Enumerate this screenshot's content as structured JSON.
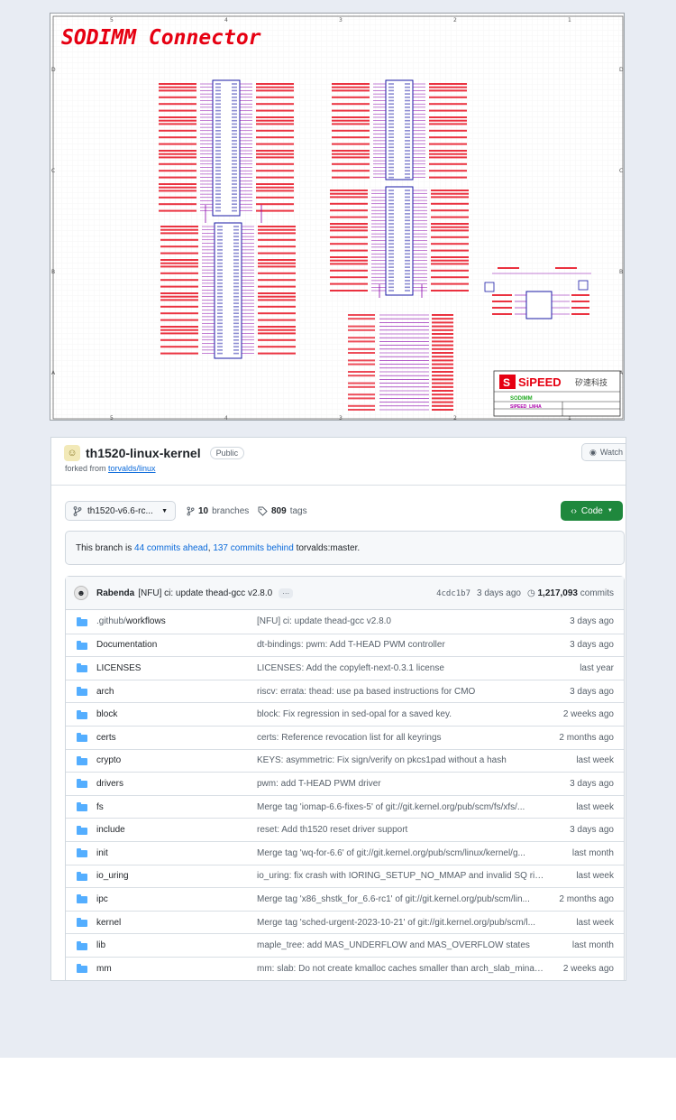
{
  "schematic": {
    "title": "SODIMM Connector",
    "brand": "SiPEED",
    "brand_cn": "矽速科技",
    "sheet_name": "SODIMM",
    "project": "SIPEED_LM4A",
    "colors": {
      "title": "#e60012",
      "net": "#e60012",
      "wire": "#8800aa",
      "part": "#1a1aa6"
    }
  },
  "repo": {
    "name": "th1520-linux-kernel",
    "visibility": "Public",
    "forked_prefix": "forked from",
    "forked_link": "torvalds/linux",
    "watch_label": "Watch",
    "branch_label": "th1520-v6.6-rc...",
    "branches_count": "10",
    "branches_label": "branches",
    "tags_count": "809",
    "tags_label": "tags",
    "code_label": "Code",
    "ahead": {
      "prefix": "This branch is",
      "ahead_text": "44 commits ahead",
      "sep": ",",
      "behind_text": "137 commits behind",
      "suffix": "torvalds:master."
    },
    "latest_commit": {
      "author": "Rabenda",
      "message": "[NFU] ci: update thead-gcc v2.8.0",
      "ellipsis": "···",
      "hash": "4cdc1b7",
      "age": "3 days ago",
      "count": "1,217,093",
      "count_label": "commits"
    },
    "files": [
      {
        "name_dim": ".github/",
        "name": "workflows",
        "message": "[NFU] ci: update thead-gcc v2.8.0",
        "age": "3 days ago"
      },
      {
        "name_dim": "",
        "name": "Documentation",
        "message": "dt-bindings: pwm: Add T-HEAD PWM controller",
        "age": "3 days ago"
      },
      {
        "name_dim": "",
        "name": "LICENSES",
        "message": "LICENSES: Add the copyleft-next-0.3.1 license",
        "age": "last year"
      },
      {
        "name_dim": "",
        "name": "arch",
        "message": "riscv: errata: thead: use pa based instructions for CMO",
        "age": "3 days ago"
      },
      {
        "name_dim": "",
        "name": "block",
        "message": "block: Fix regression in sed-opal for a saved key.",
        "age": "2 weeks ago"
      },
      {
        "name_dim": "",
        "name": "certs",
        "message": "certs: Reference revocation list for all keyrings",
        "age": "2 months ago"
      },
      {
        "name_dim": "",
        "name": "crypto",
        "message": "KEYS: asymmetric: Fix sign/verify on pkcs1pad without a hash",
        "age": "last week"
      },
      {
        "name_dim": "",
        "name": "drivers",
        "message": "pwm: add T-HEAD PWM driver",
        "age": "3 days ago"
      },
      {
        "name_dim": "",
        "name": "fs",
        "message": "Merge tag 'iomap-6.6-fixes-5' of git://git.kernel.org/pub/scm/fs/xfs/...",
        "age": "last week"
      },
      {
        "name_dim": "",
        "name": "include",
        "message": "reset: Add th1520 reset driver support",
        "age": "3 days ago"
      },
      {
        "name_dim": "",
        "name": "init",
        "message": "Merge tag 'wq-for-6.6' of git://git.kernel.org/pub/scm/linux/kernel/g...",
        "age": "last month"
      },
      {
        "name_dim": "",
        "name": "io_uring",
        "message": "io_uring: fix crash with IORING_SETUP_NO_MMAP and invalid SQ rin...",
        "age": "last week"
      },
      {
        "name_dim": "",
        "name": "ipc",
        "message": "Merge tag 'x86_shstk_for_6.6-rc1' of git://git.kernel.org/pub/scm/lin...",
        "age": "2 months ago"
      },
      {
        "name_dim": "",
        "name": "kernel",
        "message": "Merge tag 'sched-urgent-2023-10-21' of git://git.kernel.org/pub/scm/l...",
        "age": "last week"
      },
      {
        "name_dim": "",
        "name": "lib",
        "message": "maple_tree: add MAS_UNDERFLOW and MAS_OVERFLOW states",
        "age": "last month"
      },
      {
        "name_dim": "",
        "name": "mm",
        "message": "mm: slab: Do not create kmalloc caches smaller than arch_slab_minali...",
        "age": "2 weeks ago"
      }
    ]
  }
}
